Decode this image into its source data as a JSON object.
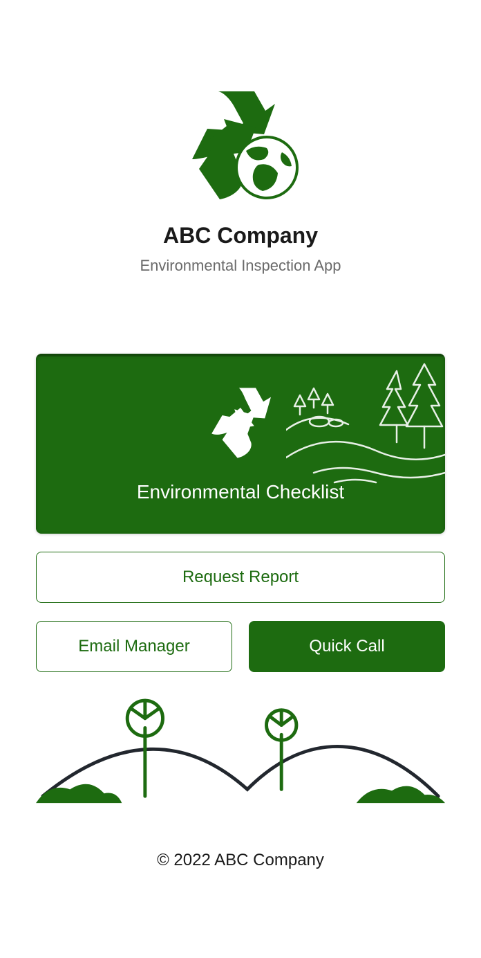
{
  "header": {
    "company": "ABC Company",
    "subtitle": "Environmental Inspection App"
  },
  "card": {
    "title": "Environmental Checklist"
  },
  "buttons": {
    "request_report": "Request Report",
    "email_manager": "Email Manager",
    "quick_call": "Quick Call"
  },
  "footer": {
    "copyright": "© 2022 ABC Company"
  },
  "colors": {
    "brand_green": "#1d6b10",
    "text_dark": "#1a1a1a",
    "text_muted": "#6a6a6a"
  }
}
